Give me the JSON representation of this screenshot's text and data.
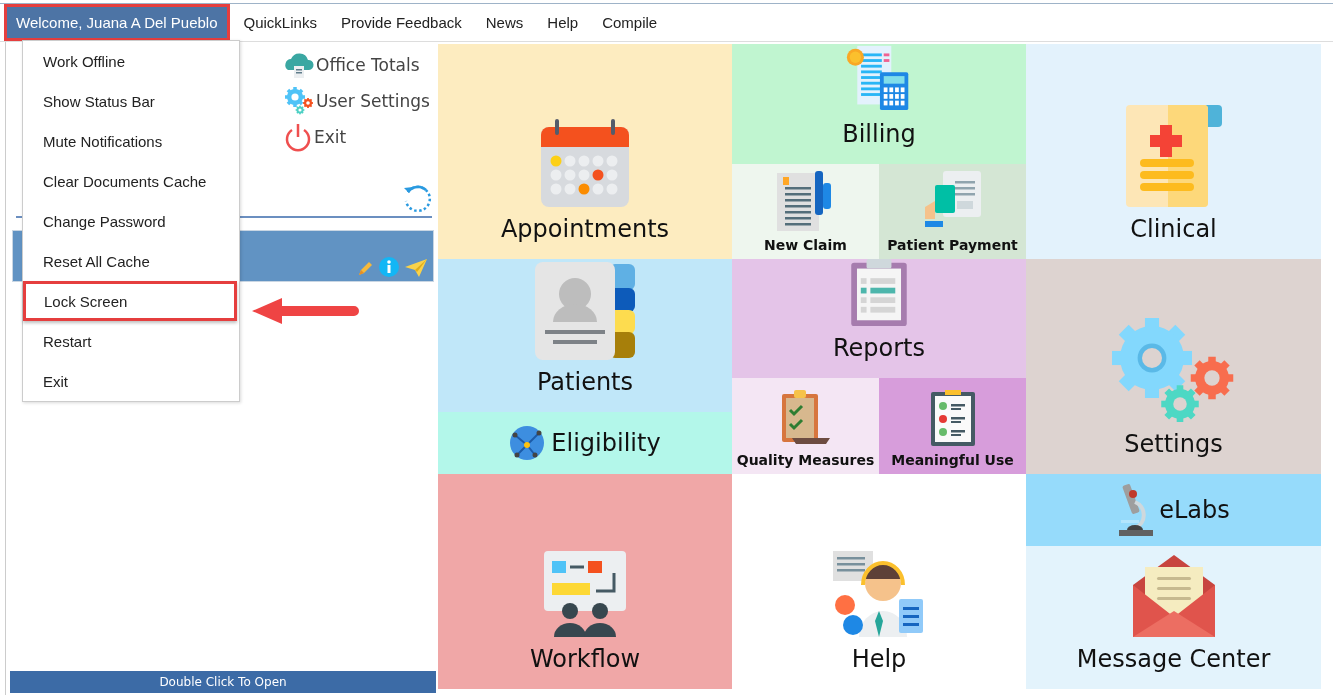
{
  "menu_bar": {
    "items": [
      {
        "label": "Welcome, Juana A Del Pueblo",
        "selected": true,
        "highlighted": true
      },
      {
        "label": "QuickLinks",
        "selected": false,
        "highlighted": false
      },
      {
        "label": "Provide Feedback",
        "selected": false,
        "highlighted": false
      },
      {
        "label": "News",
        "selected": false,
        "highlighted": false
      },
      {
        "label": "Help",
        "selected": false,
        "highlighted": false
      },
      {
        "label": "Compile",
        "selected": false,
        "highlighted": false
      }
    ]
  },
  "user_menu": {
    "items": [
      {
        "label": "Work Offline",
        "highlighted": false
      },
      {
        "label": "Show Status Bar",
        "highlighted": false
      },
      {
        "label": "Mute Notifications",
        "highlighted": false
      },
      {
        "label": "Clear Documents Cache",
        "highlighted": false
      },
      {
        "label": "Change Password",
        "highlighted": false
      },
      {
        "label": "Reset All Cache",
        "highlighted": false
      },
      {
        "label": "Lock Screen",
        "highlighted": true
      },
      {
        "label": "Restart",
        "highlighted": false
      },
      {
        "label": "Exit",
        "highlighted": false
      }
    ]
  },
  "quick_links": [
    {
      "label": "Office Totals"
    },
    {
      "label": "User Settings"
    },
    {
      "label": "Exit"
    }
  ],
  "panel": {
    "footer": "Double Click To Open"
  },
  "tiles": [
    [
      {
        "label": "Appointments",
        "kind": "big"
      },
      {
        "label": "Patients",
        "kind": "big"
      },
      {
        "label": "Eligibility",
        "kind": "banner"
      },
      {
        "label": "Workflow",
        "kind": "big"
      }
    ],
    [
      {
        "label": "Billing",
        "kind": "big"
      },
      {
        "kind": "pair",
        "items": [
          {
            "label": "New Claim"
          },
          {
            "label": "Patient Payment"
          }
        ]
      },
      {
        "label": "Reports",
        "kind": "big"
      },
      {
        "kind": "pair",
        "items": [
          {
            "label": "Quality Measures"
          },
          {
            "label": "Meaningful Use"
          }
        ]
      },
      {
        "label": "Help",
        "kind": "big"
      }
    ],
    [
      {
        "label": "Clinical",
        "kind": "big"
      },
      {
        "label": "Settings",
        "kind": "big"
      },
      {
        "label": "eLabs",
        "kind": "banner"
      },
      {
        "label": "Message Center",
        "kind": "big"
      }
    ]
  ]
}
